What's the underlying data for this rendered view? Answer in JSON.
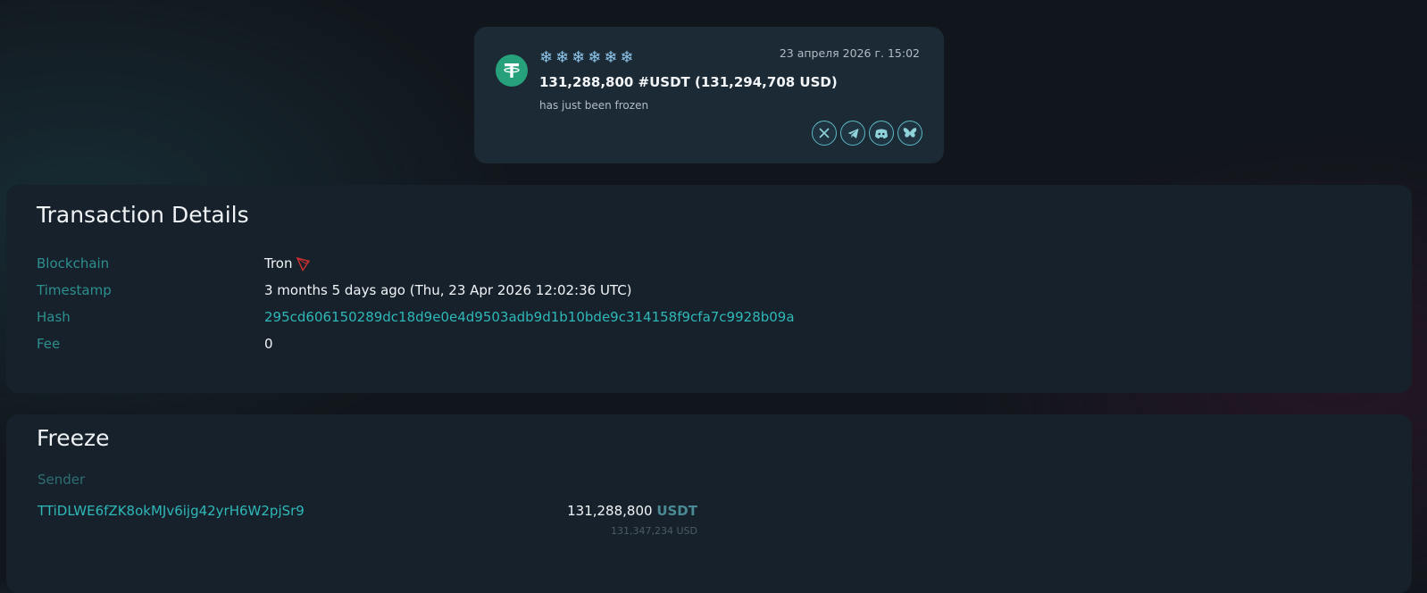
{
  "alert": {
    "snowflakes": "❄❄❄❄❄❄",
    "date": "23 апреля 2026 г. 15:02",
    "amount_line": "131,288,800 #USDT (131,294,708 USD)",
    "status": "has just been frozen",
    "share_icons": [
      "x-logo-icon",
      "telegram-icon",
      "discord-icon",
      "bluesky-icon"
    ]
  },
  "details": {
    "title": "Transaction Details",
    "rows": [
      {
        "label": "Blockchain",
        "value": "Tron"
      },
      {
        "label": "Timestamp",
        "value": "3 months 5 days ago (Thu, 23 Apr 2026 12:02:36 UTC)"
      },
      {
        "label": "Hash",
        "value": "295cd606150289dc18d9e0e4d9503adb9d1b10bde9c314158f9cfa7c9928b09a"
      },
      {
        "label": "Fee",
        "value": "0"
      }
    ]
  },
  "freeze": {
    "title": "Freeze",
    "sender_label": "Sender",
    "sender_address": "TTiDLWE6fZK8okMJv6ijg42yrH6W2pjSr9",
    "amount": "131,288,800",
    "currency": "USDT",
    "usd_value": "131,347,234 USD"
  },
  "colors": {
    "accent": "#2fb8b8",
    "tether_green": "#26a17b",
    "tron_red": "#c8302f"
  }
}
